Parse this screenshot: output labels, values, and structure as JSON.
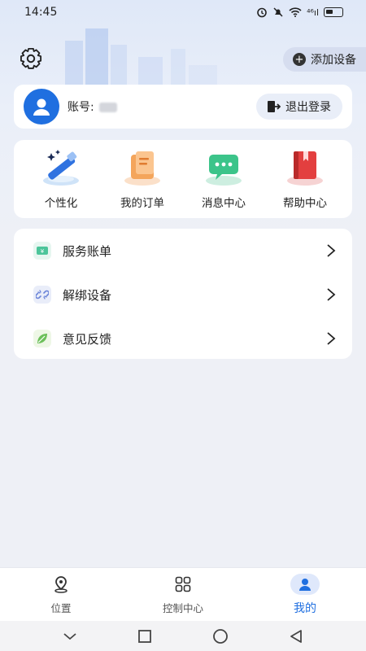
{
  "status_bar": {
    "time": "14:45",
    "network": "⁴⁶ıl"
  },
  "header": {
    "add_device_label": "添加设备"
  },
  "account": {
    "label": "账号:",
    "logout_label": "退出登录"
  },
  "shortcuts": [
    {
      "label": "个性化",
      "icon": "magic-wand-icon"
    },
    {
      "label": "我的订单",
      "icon": "order-icon"
    },
    {
      "label": "消息中心",
      "icon": "message-icon"
    },
    {
      "label": "帮助中心",
      "icon": "help-book-icon"
    }
  ],
  "menu": [
    {
      "label": "服务账单",
      "icon": "bill-icon"
    },
    {
      "label": "解绑设备",
      "icon": "unlink-icon"
    },
    {
      "label": "意见反馈",
      "icon": "feedback-leaf-icon"
    }
  ],
  "tabs": [
    {
      "label": "位置",
      "icon": "location-icon"
    },
    {
      "label": "控制中心",
      "icon": "grid-icon"
    },
    {
      "label": "我的",
      "icon": "profile-icon",
      "active": true
    }
  ],
  "colors": {
    "accent": "#1f6fe0",
    "background": "#eef0f6"
  }
}
